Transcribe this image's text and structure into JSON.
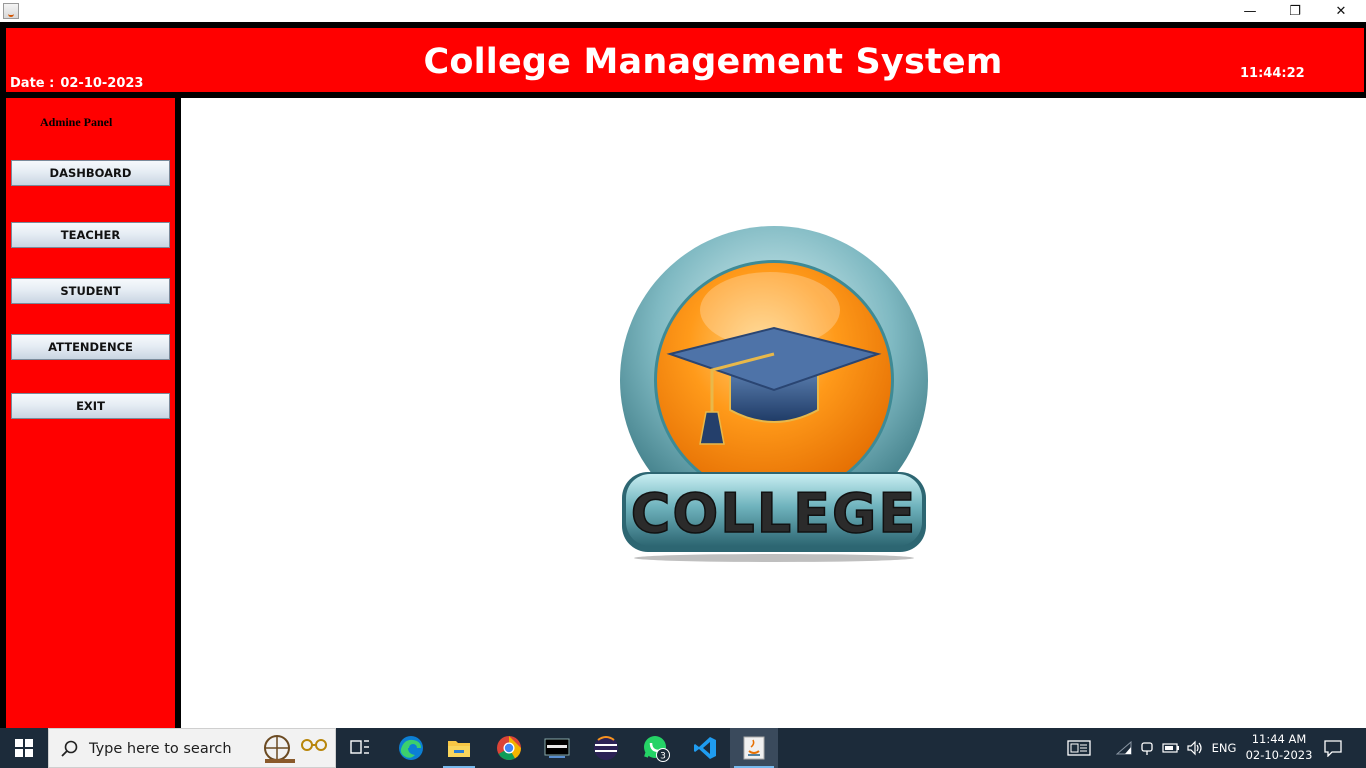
{
  "window": {
    "controls": {
      "minimize": "—",
      "restore": "❐",
      "close": "✕"
    }
  },
  "header": {
    "title": "College Management System",
    "date_label": "Date :",
    "date_value": "02-10-2023",
    "time": "11:44:22"
  },
  "sidebar": {
    "panel_label": "Admine Panel",
    "buttons": [
      {
        "label": "DASHBOARD"
      },
      {
        "label": "TEACHER"
      },
      {
        "label": "STUDENT"
      },
      {
        "label": "ATTENDENCE"
      },
      {
        "label": "EXIT"
      }
    ]
  },
  "main": {
    "logo_text": "COLLEGE"
  },
  "taskbar": {
    "search_placeholder": "Type here to search",
    "whatsapp_badge": "3",
    "language": "ENG",
    "time": "11:44 AM",
    "date": "02-10-2023"
  },
  "colors": {
    "header_bg": "#ff0000",
    "sidebar_bg": "#ff0000",
    "frame_border": "#000000",
    "taskbar_bg": "#1c2b3a"
  }
}
